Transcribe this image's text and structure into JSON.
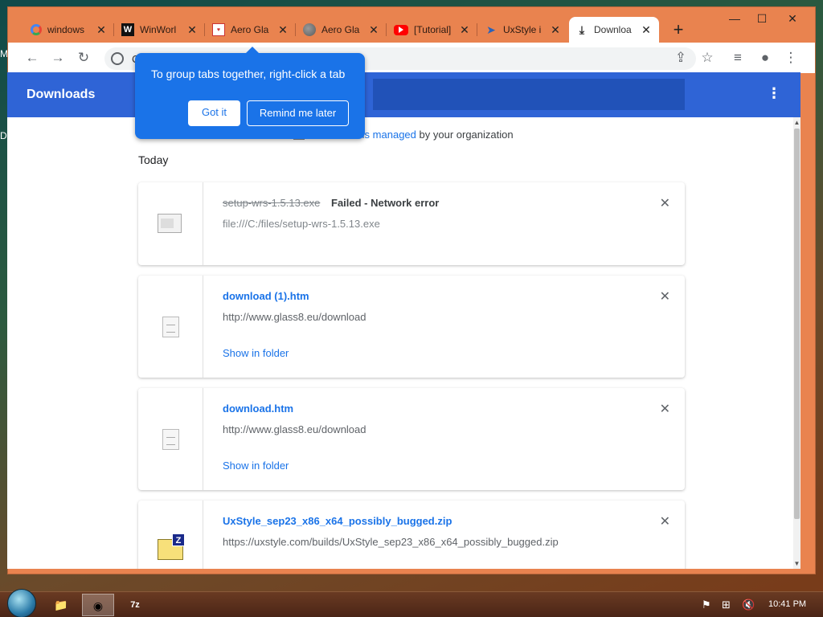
{
  "desktop": {
    "edge_letters": [
      "M",
      "D"
    ]
  },
  "tabs": [
    {
      "title": "windows",
      "favicon": "google-icon"
    },
    {
      "title": "WinWorl",
      "favicon": "winworld-icon"
    },
    {
      "title": "Aero Gla",
      "favicon": "aero-icon"
    },
    {
      "title": "Aero Gla",
      "favicon": "globe-icon"
    },
    {
      "title": "[Tutorial]",
      "favicon": "youtube-icon"
    },
    {
      "title": "UxStyle i",
      "favicon": "uxstyle-icon"
    },
    {
      "title": "Downloa",
      "favicon": "download-icon"
    }
  ],
  "omnibox": {
    "text": "C"
  },
  "header": {
    "title": "Downloads"
  },
  "bubble": {
    "text": "To group tabs together, right-click a tab",
    "got_it": "Got it",
    "remind": "Remind me later"
  },
  "managed": {
    "prefix": "ser is managed",
    "suffix": "by your organization",
    "link": "is managed",
    "pre": "ser "
  },
  "section": {
    "today": "Today"
  },
  "downloads": [
    {
      "name": "setup-wrs-1.5.13.exe",
      "status": "Failed - Network error",
      "url": "file:///C:/files/setup-wrs-1.5.13.exe",
      "failed": true
    },
    {
      "name": "download (1).htm",
      "url": "http://www.glass8.eu/download",
      "action": "Show in folder"
    },
    {
      "name": "download.htm",
      "url": "http://www.glass8.eu/download",
      "action": "Show in folder"
    },
    {
      "name": "UxStyle_sep23_x86_x64_possibly_bugged.zip",
      "url": "https://uxstyle.com/builds/UxStyle_sep23_x86_x64_possibly_bugged.zip"
    }
  ],
  "taskbar": {
    "clock": "10:41 PM"
  },
  "colors": {
    "frame": "#e9834f",
    "accent": "#1a73e8",
    "header": "#2f64d6"
  }
}
